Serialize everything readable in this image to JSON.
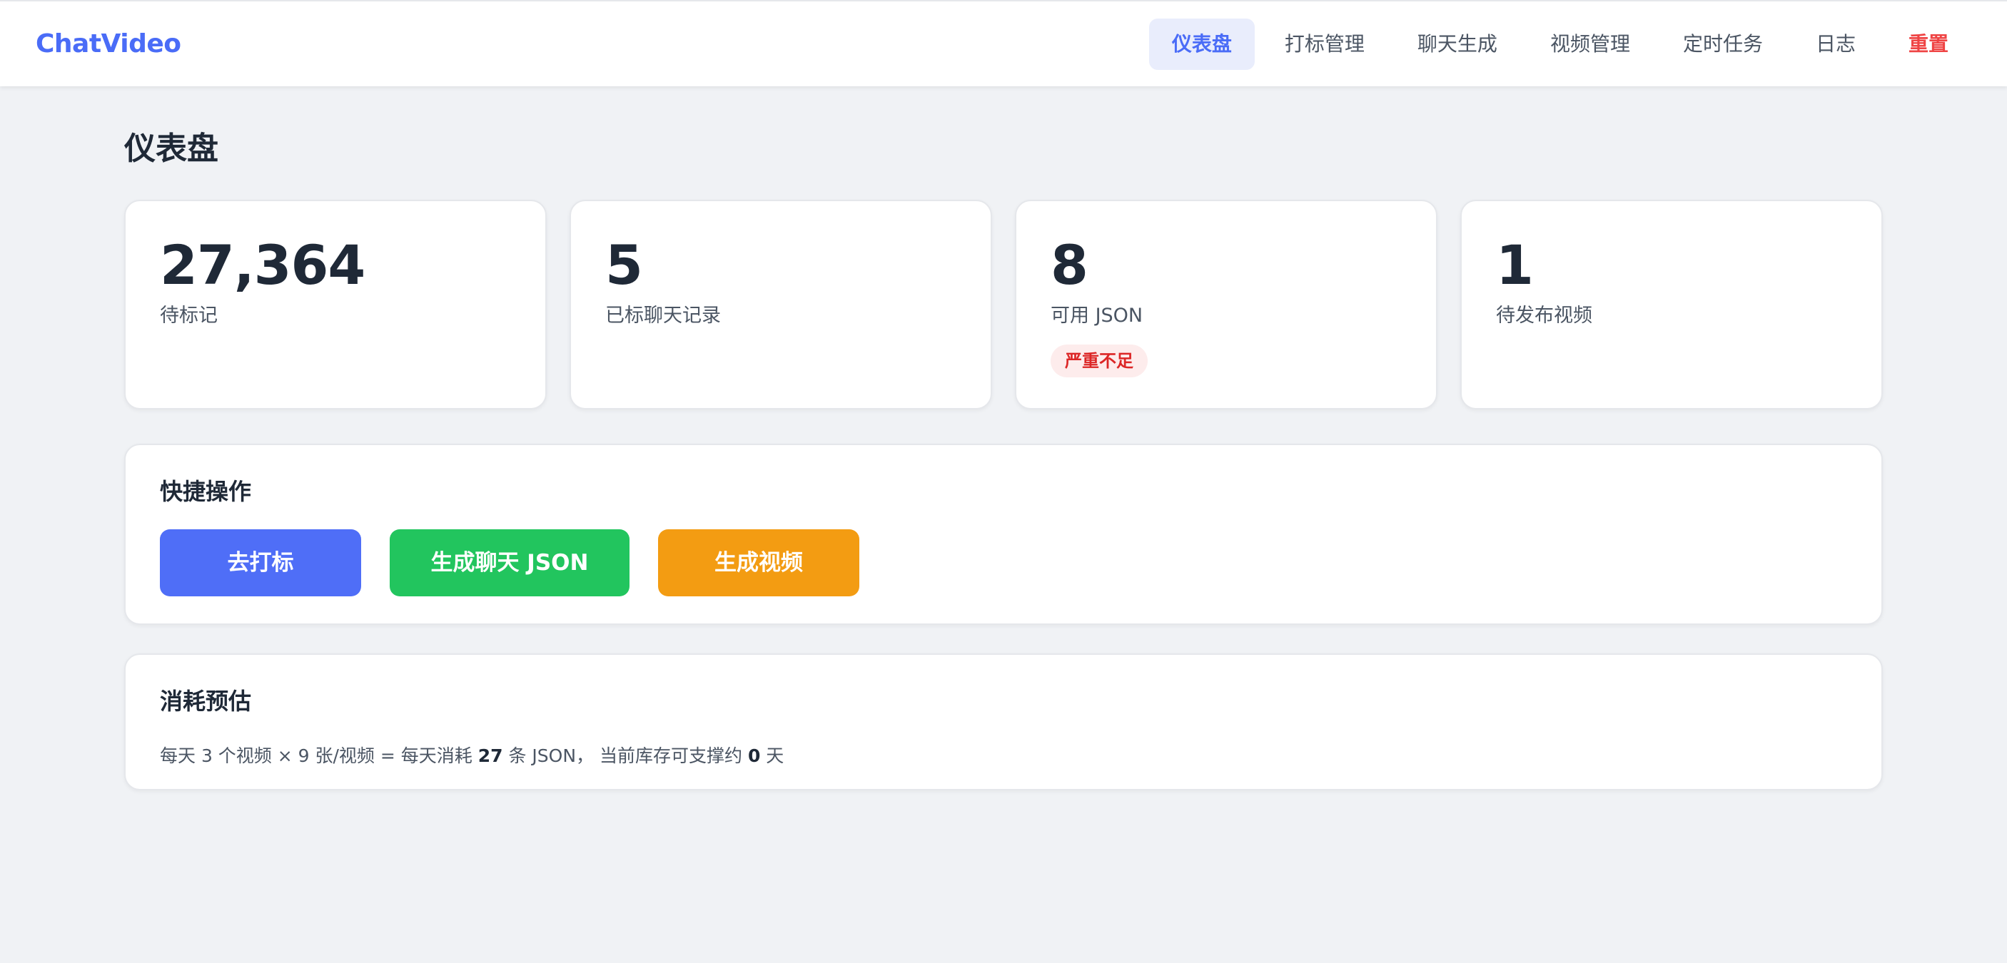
{
  "brand": "ChatVideo",
  "nav": {
    "items": [
      {
        "label": "仪表盘",
        "active": true
      },
      {
        "label": "打标管理"
      },
      {
        "label": "聊天生成"
      },
      {
        "label": "视频管理"
      },
      {
        "label": "定时任务"
      },
      {
        "label": "日志"
      },
      {
        "label": "重置",
        "danger": true
      }
    ]
  },
  "page_title": "仪表盘",
  "stats": [
    {
      "value": "27,364",
      "label": "待标记"
    },
    {
      "value": "5",
      "label": "已标聊天记录"
    },
    {
      "value": "8",
      "label": "可用 JSON",
      "badge": "严重不足"
    },
    {
      "value": "1",
      "label": "待发布视频"
    }
  ],
  "quick_actions": {
    "title": "快捷操作",
    "buttons": [
      {
        "label": "去打标",
        "color": "#4f6ef7"
      },
      {
        "label": "生成聊天 JSON",
        "color": "#22c55e"
      },
      {
        "label": "生成视频",
        "color": "#f39c12"
      }
    ]
  },
  "estimate": {
    "title": "消耗预估",
    "text_1": "每天 3 个视频 × 9 张/视频 = 每天消耗",
    "daily_json": "27",
    "text_2": "条 JSON， 当前库存可支撑约",
    "days": "0",
    "text_3": "天"
  },
  "colors": {
    "accent": "#4a6cf7",
    "danger": "#ef4444",
    "badge_bg": "#fdecec",
    "badge_text": "#dc2626"
  }
}
